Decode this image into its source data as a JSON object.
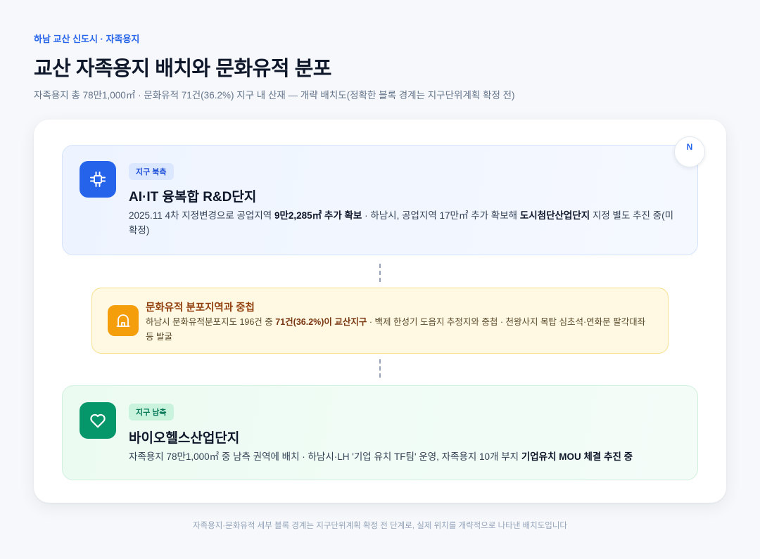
{
  "header": {
    "eyebrow": "하남 교산 신도시 · 자족용지",
    "title": "교산 자족용지 배치와 문화유적 분포",
    "subtitle": "자족용지 총 78만1,000㎡ · 문화유적 71건(36.2%) 지구 내 산재 — 개략 배치도(정확한 블록 경계는 지구단위계획 확정 전)"
  },
  "compass": {
    "label": "N"
  },
  "zones": {
    "north": {
      "icon": "chip-icon",
      "tag": "지구 북측",
      "title": "AI·IT 융복합 R&D단지",
      "desc_1": "2025.11 4차 지정변경으로 공업지역 ",
      "desc_bold_1": "9만2,285㎡ 추가 확보",
      "desc_2": " · 하남시, 공업지역 17만㎡ 추가 확보해 ",
      "desc_bold_2": "도시첨단산업단지",
      "desc_3": " 지정 별도 추진 중(미확정)"
    },
    "overlap": {
      "icon": "heritage-gate-icon",
      "title": "문화유적 분포지역과 중첩",
      "desc_1": "하남시 문화유적분포지도 196건 중 ",
      "desc_bold": "71건(36.2%)이 교산지구",
      "desc_2": " · 백제 한성기 도읍지 추정지와 중첩 · 천왕사지 목탑 심초석·연화문 팔각대좌 등 발굴"
    },
    "south": {
      "icon": "heart-icon",
      "tag": "지구 남측",
      "title": "바이오헬스산업단지",
      "desc_1": "자족용지 78만1,000㎡ 중 남측 권역에 배치 · 하남시·LH '기업 유치 TF팀' 운영, 자족용지 10개 부지 ",
      "desc_bold": "기업유치 MOU 체결 추진 중"
    }
  },
  "footnote": "자족용지·문화유적 세부 블록 경계는 지구단위계획 확정 전 단계로, 실제 위치를 개략적으로 나타낸 배치도입니다",
  "colors": {
    "accent_blue": "#2563eb",
    "accent_green": "#059669",
    "accent_amber": "#f59e0b"
  }
}
